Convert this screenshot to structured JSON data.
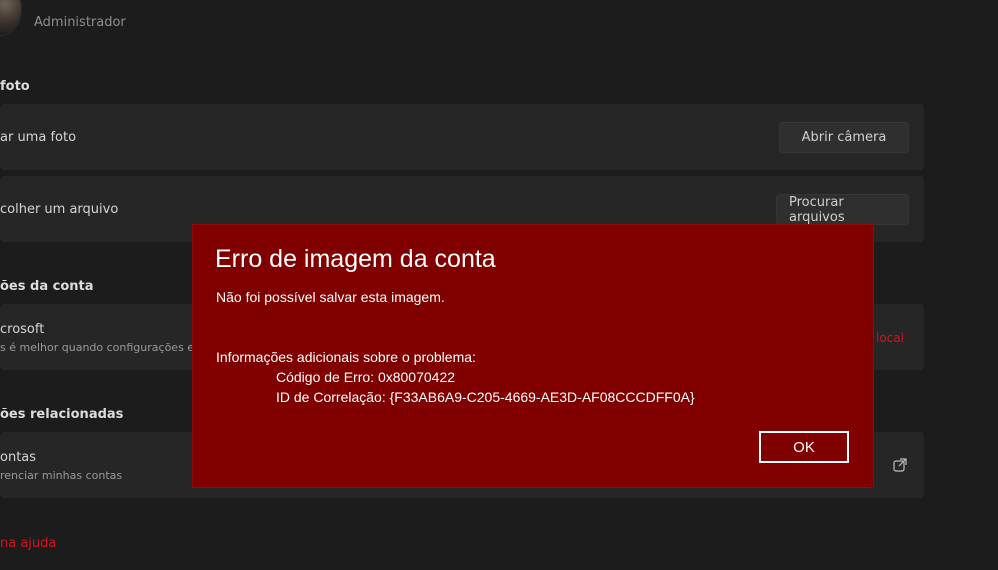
{
  "header": {
    "role": "Administrador"
  },
  "photo_section": {
    "title": "foto",
    "take_photo": {
      "label": "ar uma foto",
      "button": "Abrir câmera"
    },
    "choose_file": {
      "label": "colher um arquivo",
      "button": "Procurar arquivos"
    }
  },
  "account_settings": {
    "title": "ões da conta",
    "microsoft": {
      "label": "crosoft",
      "sublabel": "s é melhor quando configurações e",
      "link": "local"
    }
  },
  "related_settings": {
    "title": "ões relacionadas",
    "accounts": {
      "label": "ontas",
      "sublabel": "renciar minhas contas"
    }
  },
  "help_link": "na ajuda",
  "dialog": {
    "title": "Erro de imagem da conta",
    "message": "Não foi possível salvar esta imagem.",
    "details_header": "Informações adicionais sobre o problema:",
    "error_code": "Código de Erro: 0x80070422",
    "correlation_id": "ID de Correlação: {F33AB6A9-C205-4669-AE3D-AF08CCCDFF0A}",
    "ok_label": "OK"
  },
  "colors": {
    "background": "#1c1c1c",
    "card": "#262626",
    "dialog": "#800000",
    "accent_red": "#d0171c"
  },
  "icons": {
    "external_link": "external-link-icon"
  }
}
